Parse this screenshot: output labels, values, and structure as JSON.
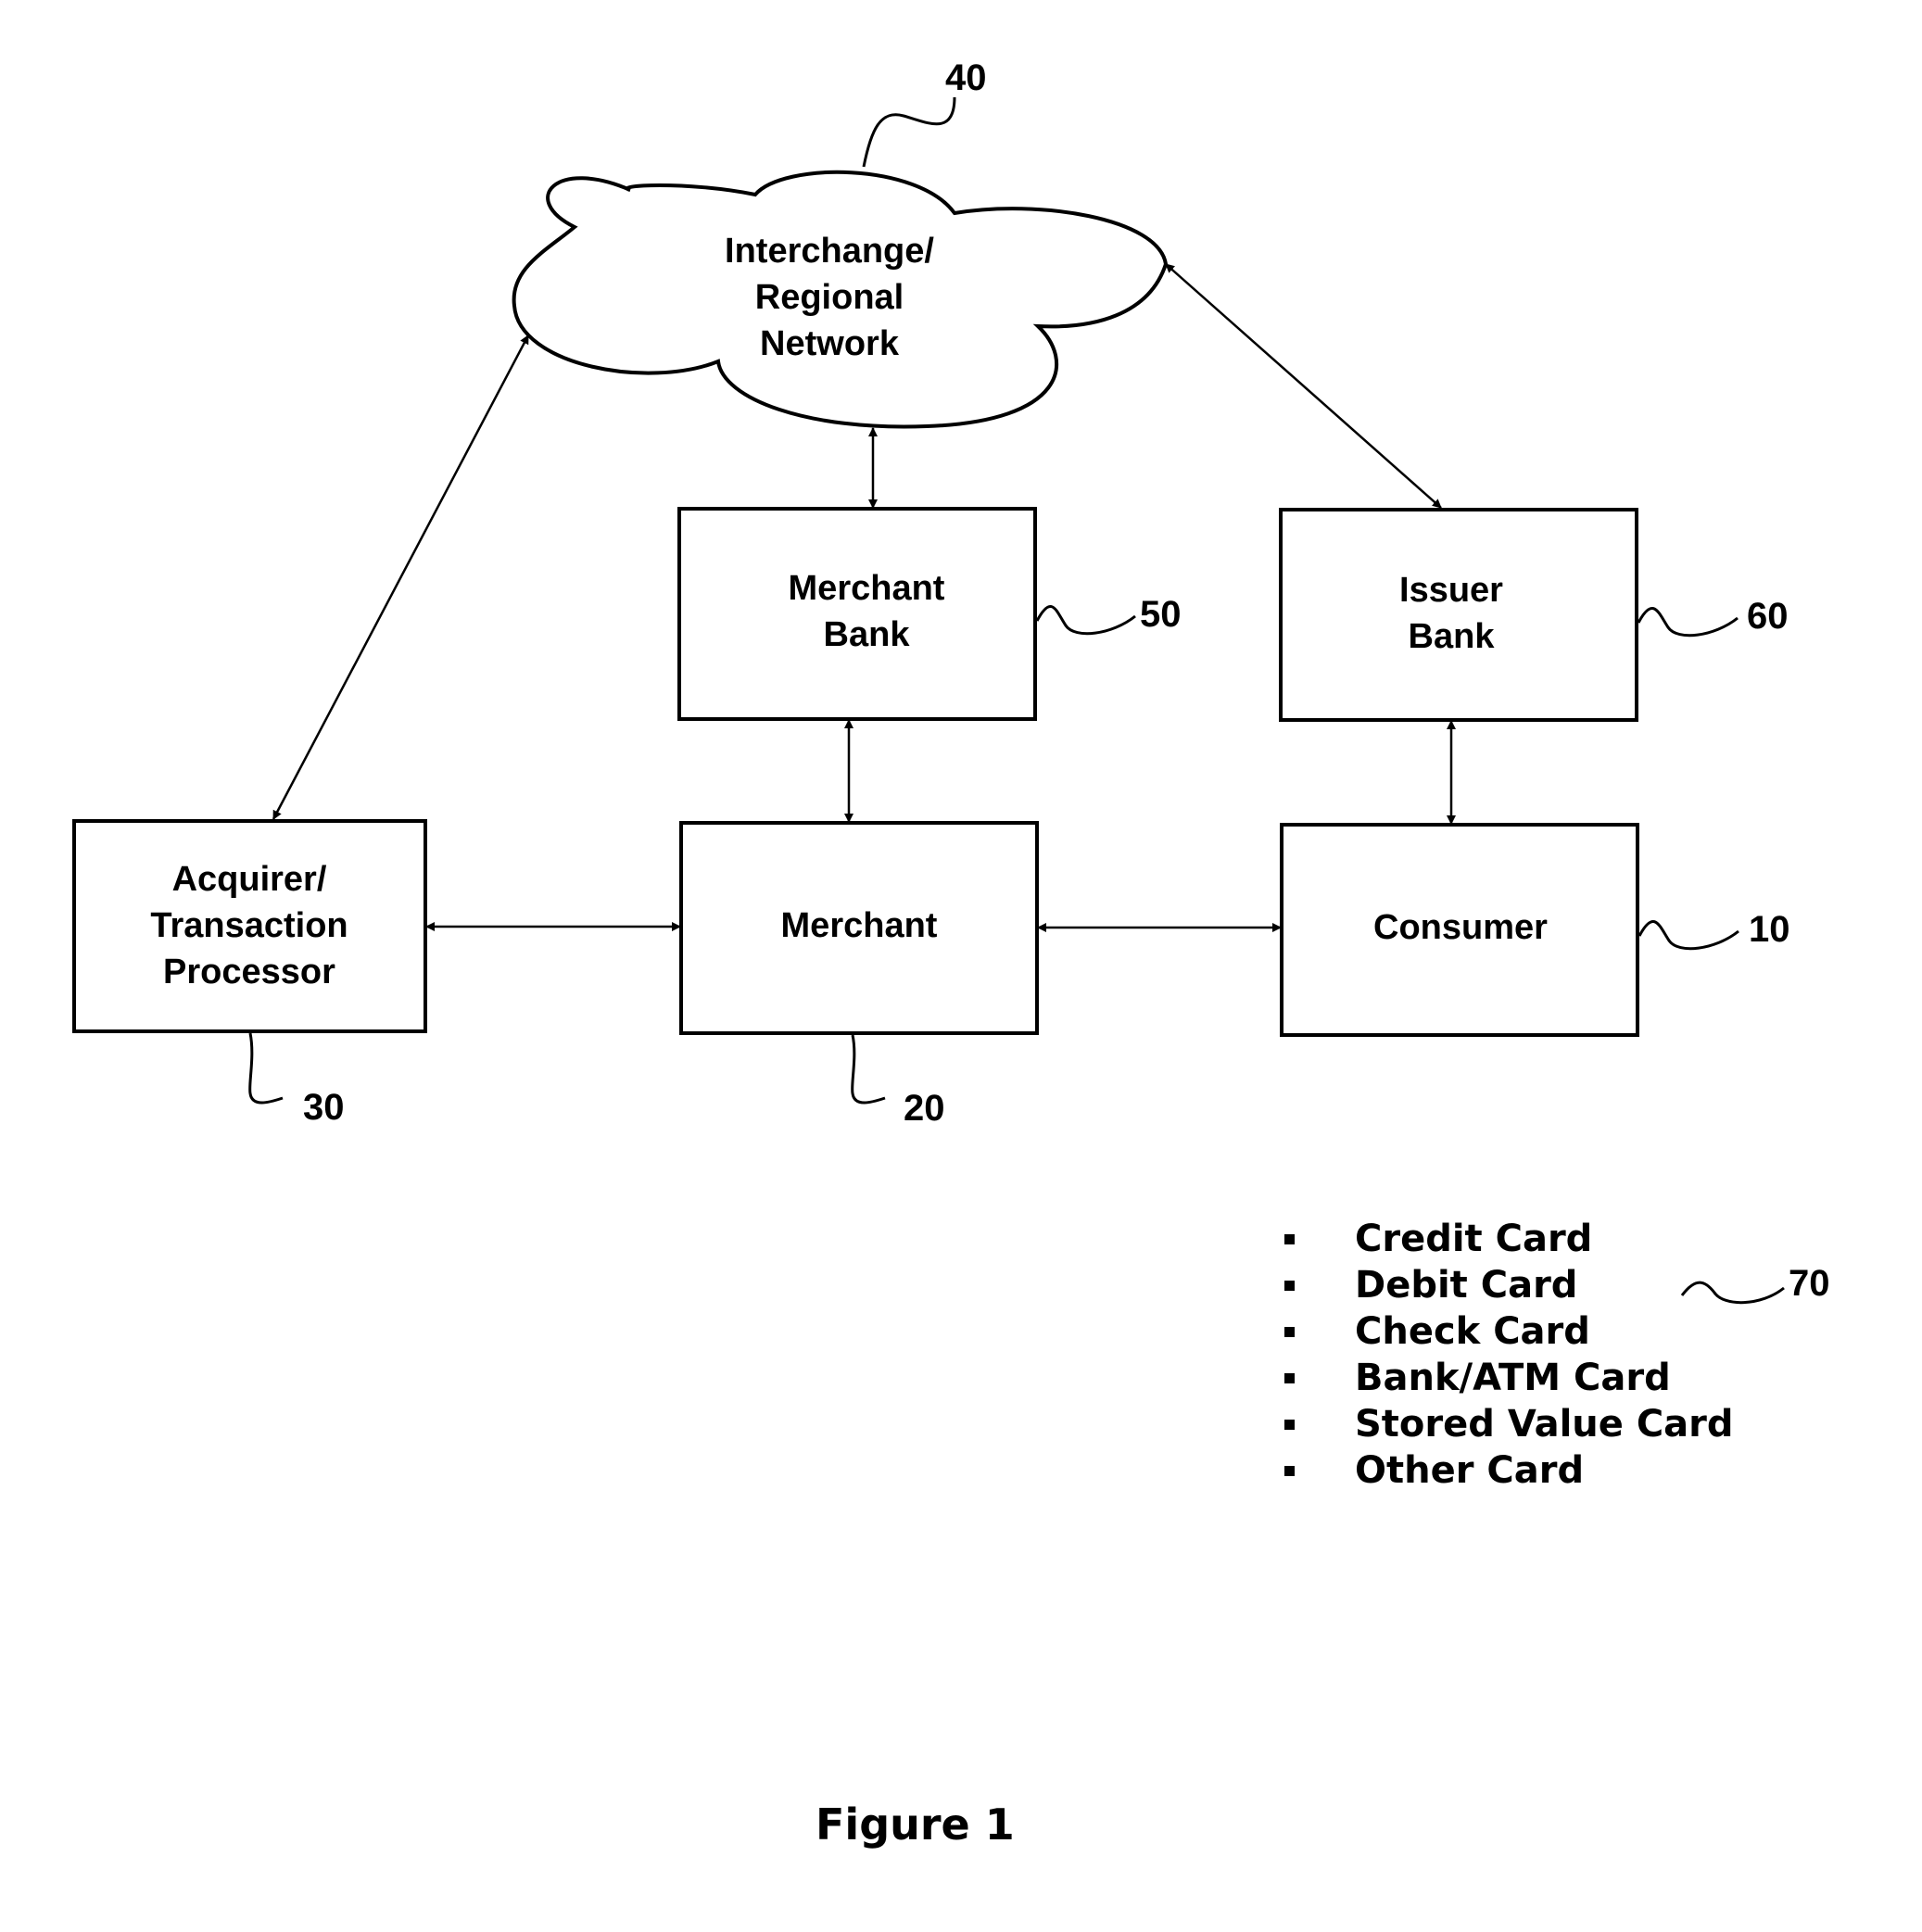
{
  "figure": {
    "caption": "Figure 1",
    "nodes": {
      "network": {
        "label_lines": [
          "Interchange/",
          "Regional",
          "Network"
        ],
        "ref": "40"
      },
      "merchant_bank": {
        "label_lines": [
          "Merchant",
          "Bank"
        ],
        "ref": "50"
      },
      "issuer_bank": {
        "label_lines": [
          "Issuer",
          "Bank"
        ],
        "ref": "60"
      },
      "acquirer": {
        "label_lines": [
          "Acquirer/",
          "Transaction",
          "Processor"
        ],
        "ref": "30"
      },
      "merchant": {
        "label_lines": [
          "Merchant"
        ],
        "ref": "20"
      },
      "consumer": {
        "label_lines": [
          "Consumer"
        ],
        "ref": "10"
      }
    },
    "edges": [
      {
        "from": "network",
        "to": "acquirer",
        "type": "bidirectional"
      },
      {
        "from": "network",
        "to": "merchant_bank",
        "type": "bidirectional"
      },
      {
        "from": "network",
        "to": "issuer_bank",
        "type": "bidirectional"
      },
      {
        "from": "merchant_bank",
        "to": "merchant",
        "type": "bidirectional"
      },
      {
        "from": "issuer_bank",
        "to": "consumer",
        "type": "bidirectional"
      },
      {
        "from": "acquirer",
        "to": "merchant",
        "type": "bidirectional"
      },
      {
        "from": "merchant",
        "to": "consumer",
        "type": "bidirectional"
      }
    ],
    "card_list": {
      "ref": "70",
      "items": [
        "Credit Card",
        "Debit Card",
        "Check Card",
        "Bank/ATM Card",
        "Stored Value Card",
        "Other Card"
      ]
    }
  }
}
